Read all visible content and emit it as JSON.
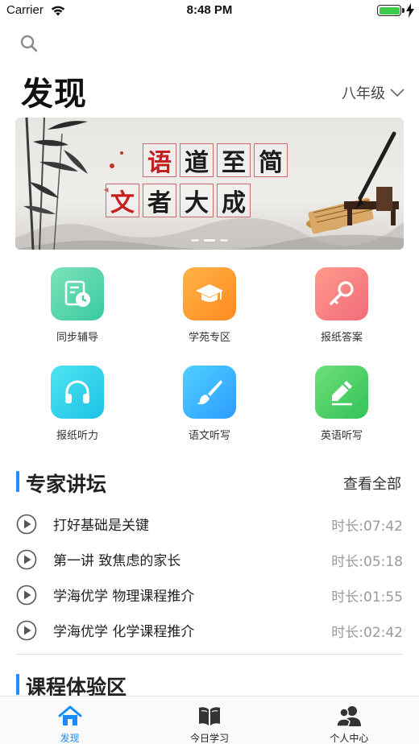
{
  "status_bar": {
    "carrier": "Carrier",
    "time": "8:48 PM"
  },
  "header": {
    "title": "发现",
    "grade": "八年级"
  },
  "banner": {
    "row1": [
      "语",
      "道",
      "至",
      "简"
    ],
    "row2": [
      "文",
      "者",
      "大",
      "成"
    ],
    "slide_count": 3,
    "active_slide": 2
  },
  "features": [
    {
      "label": "同步辅导",
      "icon": "sync-tutoring-icon",
      "color_from": "#7ee3b8",
      "color_to": "#38c9a0"
    },
    {
      "label": "学苑专区",
      "icon": "graduation-cap-icon",
      "color_from": "#ffb347",
      "color_to": "#ff8a1f"
    },
    {
      "label": "报纸答案",
      "icon": "key-icon",
      "color_from": "#ff9a8b",
      "color_to": "#f26b7a"
    },
    {
      "label": "报纸听力",
      "icon": "headphones-icon",
      "color_from": "#4fe3f0",
      "color_to": "#1cc3e6"
    },
    {
      "label": "语文听写",
      "icon": "brush-icon",
      "color_from": "#4fd0ff",
      "color_to": "#2d9cff"
    },
    {
      "label": "英语听写",
      "icon": "pencil-icon",
      "color_from": "#6fe07a",
      "color_to": "#33c257"
    }
  ],
  "expert_section": {
    "title": "专家讲坛",
    "view_all": "查看全部",
    "lectures": [
      {
        "title": "打好基础是关键",
        "duration": "时长:07:42"
      },
      {
        "title": "第一讲 致焦虑的家长",
        "duration": "时长:05:18"
      },
      {
        "title": "学海优学 物理课程推介",
        "duration": "时长:01:55"
      },
      {
        "title": "学海优学 化学课程推介",
        "duration": "时长:02:42"
      }
    ]
  },
  "course_section": {
    "title": "课程体验区"
  },
  "tabbar": {
    "tabs": [
      {
        "label": "发现",
        "icon": "home-icon",
        "active": true
      },
      {
        "label": "今日学习",
        "icon": "book-icon",
        "active": false
      },
      {
        "label": "个人中心",
        "icon": "users-icon",
        "active": false
      }
    ]
  },
  "colors": {
    "accent": "#1a8cff",
    "section_bar": "#1e90ff",
    "muted": "#9a9a9a"
  }
}
